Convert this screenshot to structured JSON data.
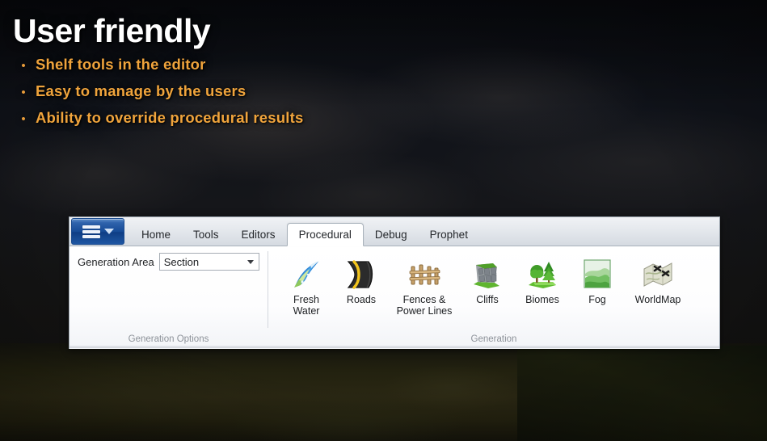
{
  "slide": {
    "title": "User friendly",
    "bullet_marker": "•",
    "bullets": [
      "Shelf tools in the editor",
      "Easy to manage by the users",
      "Ability to override procedural results"
    ],
    "title_color": "#ffffff",
    "bullet_color": "#f0a43c"
  },
  "ribbon": {
    "app_button": {
      "name": "application-menu",
      "caret": "▼"
    },
    "tabs": [
      {
        "label": "Home",
        "active": false
      },
      {
        "label": "Tools",
        "active": false
      },
      {
        "label": "Editors",
        "active": false
      },
      {
        "label": "Procedural",
        "active": true
      },
      {
        "label": "Debug",
        "active": false
      },
      {
        "label": "Prophet",
        "active": false
      }
    ],
    "groups": [
      {
        "label": "Generation Options",
        "field_label": "Generation Area",
        "combo": {
          "value": "Section",
          "caret": "▼"
        }
      },
      {
        "label": "Generation",
        "items": [
          {
            "label": "Fresh\nWater",
            "line1": "Fresh",
            "line2": "Water",
            "icon": "fresh-water-icon"
          },
          {
            "label": "Roads",
            "line1": "Roads",
            "line2": "",
            "icon": "roads-icon"
          },
          {
            "label": "Fences &\nPower Lines",
            "line1": "Fences &",
            "line2": "Power Lines",
            "icon": "fences-power-lines-icon"
          },
          {
            "label": "Cliffs",
            "line1": "Cliffs",
            "line2": "",
            "icon": "cliffs-icon"
          },
          {
            "label": "Biomes",
            "line1": "Biomes",
            "line2": "",
            "icon": "biomes-icon"
          },
          {
            "label": "Fog",
            "line1": "Fog",
            "line2": "",
            "icon": "fog-icon"
          },
          {
            "label": "WorldMap",
            "line1": "WorldMap",
            "line2": "",
            "icon": "worldmap-icon"
          }
        ]
      }
    ]
  }
}
